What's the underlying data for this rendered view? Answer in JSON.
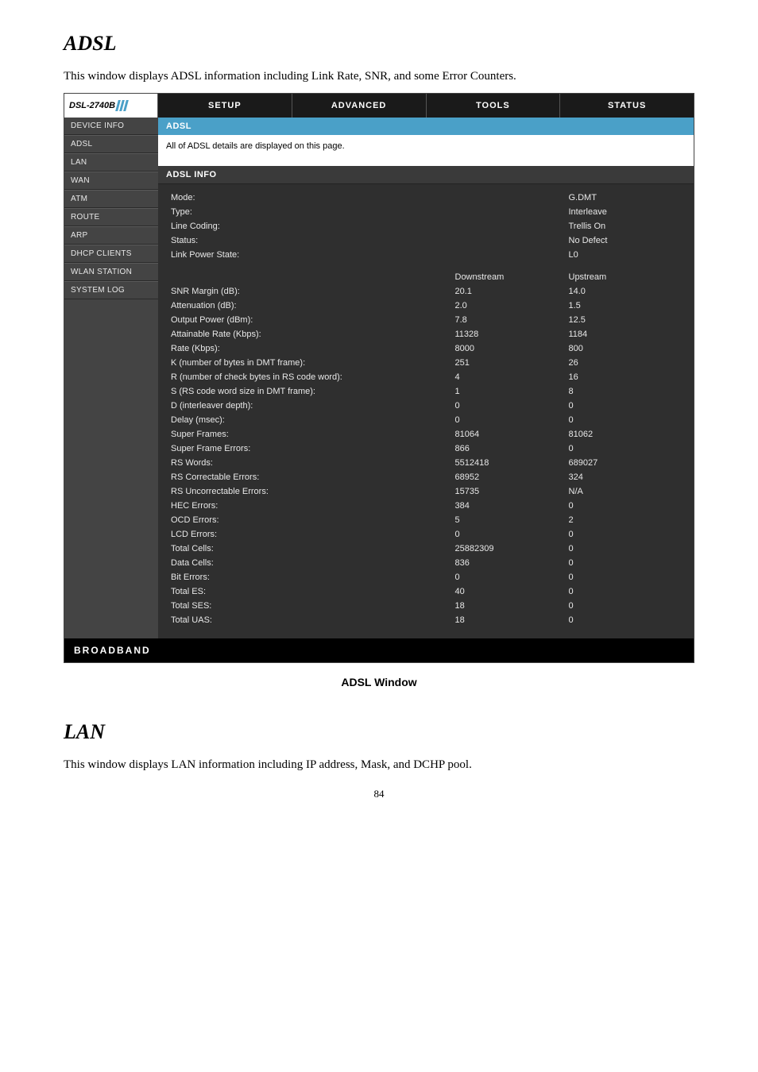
{
  "page": {
    "adsl_heading": "ADSL",
    "adsl_intro": "This window displays ADSL information including Link Rate, SNR, and some Error Counters.",
    "caption": "ADSL Window",
    "lan_heading": "LAN",
    "lan_intro": "This window displays LAN information including IP address, Mask, and DCHP pool.",
    "page_number": "84"
  },
  "brand": "DSL-2740B",
  "tabs": {
    "setup": "SETUP",
    "advanced": "ADVANCED",
    "tools": "TOOLS",
    "status": "STATUS"
  },
  "sidebar": [
    "DEVICE INFO",
    "ADSL",
    "LAN",
    "WAN",
    "ATM",
    "ROUTE",
    "ARP",
    "DHCP CLIENTS",
    "WLAN STATION",
    "SYSTEM LOG"
  ],
  "panel": {
    "title": "ADSL",
    "description": "All of ADSL details are displayed on this page.",
    "subhead": "ADSL INFO"
  },
  "top_rows": [
    {
      "label": "Mode:",
      "value": "G.DMT"
    },
    {
      "label": "Type:",
      "value": "Interleave"
    },
    {
      "label": "Line Coding:",
      "value": "Trellis On"
    },
    {
      "label": "Status:",
      "value": "No Defect"
    },
    {
      "label": "Link Power State:",
      "value": "L0"
    }
  ],
  "cols": {
    "ds": "Downstream",
    "us": "Upstream"
  },
  "stat_rows": [
    {
      "label": "SNR Margin (dB):",
      "ds": "20.1",
      "us": "14.0"
    },
    {
      "label": "Attenuation (dB):",
      "ds": "2.0",
      "us": "1.5"
    },
    {
      "label": "Output Power (dBm):",
      "ds": "7.8",
      "us": "12.5"
    },
    {
      "label": "Attainable Rate (Kbps):",
      "ds": "11328",
      "us": "1184"
    },
    {
      "label": "Rate (Kbps):",
      "ds": "8000",
      "us": "800"
    },
    {
      "label": "K (number of bytes in DMT frame):",
      "ds": "251",
      "us": "26"
    },
    {
      "label": "R (number of check bytes in RS code word):",
      "ds": "4",
      "us": "16"
    },
    {
      "label": "S (RS code word size in DMT frame):",
      "ds": "1",
      "us": "8"
    },
    {
      "label": "D (interleaver depth):",
      "ds": "0",
      "us": "0"
    },
    {
      "label": "Delay (msec):",
      "ds": "0",
      "us": "0"
    },
    {
      "label": "Super Frames:",
      "ds": "81064",
      "us": "81062"
    },
    {
      "label": "Super Frame Errors:",
      "ds": "866",
      "us": "0"
    },
    {
      "label": "RS Words:",
      "ds": "5512418",
      "us": "689027"
    },
    {
      "label": "RS Correctable Errors:",
      "ds": "68952",
      "us": "324"
    },
    {
      "label": "RS Uncorrectable Errors:",
      "ds": "15735",
      "us": "N/A"
    },
    {
      "label": "HEC Errors:",
      "ds": "384",
      "us": "0"
    },
    {
      "label": "OCD Errors:",
      "ds": "5",
      "us": "2"
    },
    {
      "label": "LCD Errors:",
      "ds": "0",
      "us": "0"
    },
    {
      "label": "Total Cells:",
      "ds": "25882309",
      "us": "0"
    },
    {
      "label": "Data Cells:",
      "ds": "836",
      "us": "0"
    },
    {
      "label": "Bit Errors:",
      "ds": "0",
      "us": "0"
    },
    {
      "label": "Total ES:",
      "ds": "40",
      "us": "0"
    },
    {
      "label": "Total SES:",
      "ds": "18",
      "us": "0"
    },
    {
      "label": "Total UAS:",
      "ds": "18",
      "us": "0"
    }
  ],
  "footer": "BROADBAND"
}
